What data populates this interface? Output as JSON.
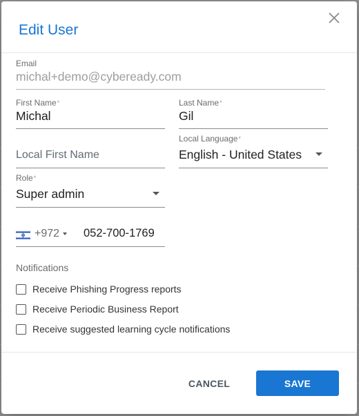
{
  "dialog": {
    "title": "Edit User",
    "close_icon": "close-icon"
  },
  "form": {
    "email": {
      "label": "Email",
      "value": "michal+demo@cybeready.com"
    },
    "first_name": {
      "label": "First Name",
      "required_mark": "*",
      "value": "Michal"
    },
    "last_name": {
      "label": "Last Name",
      "required_mark": "*",
      "value": "Gil"
    },
    "local_first_name": {
      "placeholder": "Local First Name"
    },
    "local_language": {
      "label": "Local Language",
      "required_mark": "*",
      "value": "English - United States"
    },
    "role": {
      "label": "Role",
      "required_mark": "*",
      "value": "Super admin"
    },
    "phone": {
      "flag_icon": "israel-flag-icon",
      "country_code": "+972",
      "number": "052-700-1769"
    }
  },
  "notifications": {
    "label": "Notifications",
    "items": [
      {
        "label": "Receive Phishing Progress reports",
        "checked": false
      },
      {
        "label": "Receive Periodic Business Report",
        "checked": false
      },
      {
        "label": "Receive suggested learning cycle notifications",
        "checked": false
      }
    ]
  },
  "actions": {
    "cancel_label": "CANCEL",
    "save_label": "SAVE"
  },
  "colors": {
    "accent": "#1976d2",
    "backdrop": "#8f8f8f"
  }
}
